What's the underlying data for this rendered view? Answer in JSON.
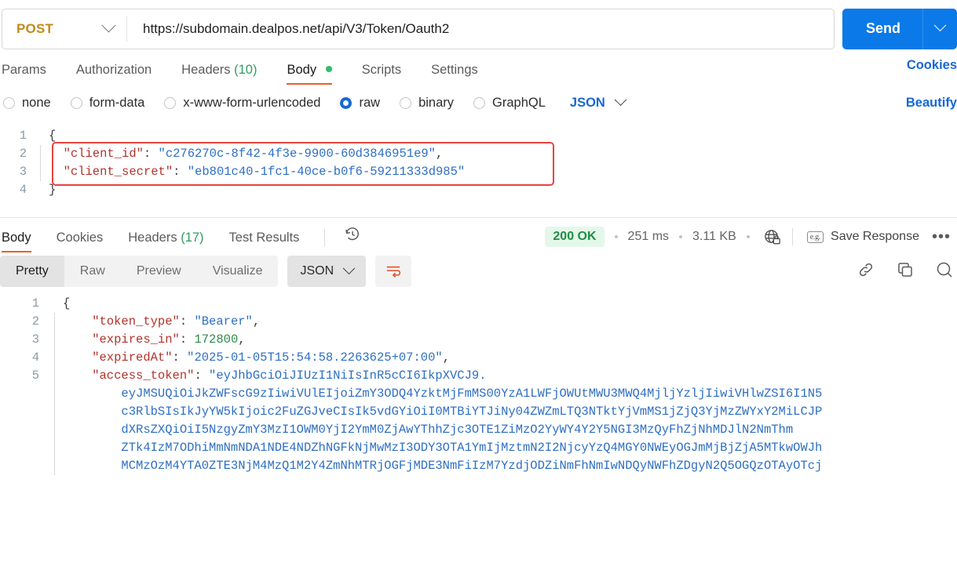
{
  "request": {
    "method": "POST",
    "url": "https://subdomain.dealpos.net/api/V3/Token/Oauth2",
    "send_label": "Send",
    "tabs": [
      {
        "label": "Params",
        "count": "",
        "active": false,
        "dot": false
      },
      {
        "label": "Authorization",
        "count": "",
        "active": false,
        "dot": false
      },
      {
        "label": "Headers",
        "count": "(10)",
        "active": false,
        "dot": false
      },
      {
        "label": "Body",
        "count": "",
        "active": true,
        "dot": true
      },
      {
        "label": "Scripts",
        "count": "",
        "active": false,
        "dot": false
      },
      {
        "label": "Settings",
        "count": "",
        "active": false,
        "dot": false
      }
    ],
    "cookies_link": "Cookies",
    "beautify_link": "Beautify",
    "body_types": [
      {
        "label": "none",
        "selected": false
      },
      {
        "label": "form-data",
        "selected": false
      },
      {
        "label": "x-www-form-urlencoded",
        "selected": false
      },
      {
        "label": "raw",
        "selected": true
      },
      {
        "label": "binary",
        "selected": false
      },
      {
        "label": "GraphQL",
        "selected": false
      }
    ],
    "raw_format": "JSON",
    "body_lines": [
      {
        "num": "1",
        "rule": false,
        "segments": [
          {
            "t": "{",
            "c": "p"
          }
        ]
      },
      {
        "num": "2",
        "rule": true,
        "segments": [
          {
            "t": "  \"client_id\"",
            "c": "k"
          },
          {
            "t": ": ",
            "c": "p"
          },
          {
            "t": "\"c276270c-8f42-4f3e-9900-60d3846951e9\"",
            "c": "s"
          },
          {
            "t": ",",
            "c": "p"
          }
        ]
      },
      {
        "num": "3",
        "rule": true,
        "segments": [
          {
            "t": "  \"client_secret\"",
            "c": "k"
          },
          {
            "t": ": ",
            "c": "p"
          },
          {
            "t": "\"eb801c40-1fc1-40ce-b0f6-59211333d985\"",
            "c": "s"
          }
        ]
      },
      {
        "num": "4",
        "rule": false,
        "segments": [
          {
            "t": "}",
            "c": "p"
          }
        ]
      }
    ]
  },
  "response": {
    "tabs": [
      {
        "label": "Body",
        "count": "",
        "active": true
      },
      {
        "label": "Cookies",
        "count": "",
        "active": false
      },
      {
        "label": "Headers",
        "count": "(17)",
        "active": false
      },
      {
        "label": "Test Results",
        "count": "",
        "active": false
      }
    ],
    "status": "200 OK",
    "time": "251 ms",
    "size": "3.11 KB",
    "save_response": "Save Response",
    "eg_badge": "e.g.",
    "view_modes": [
      {
        "label": "Pretty",
        "active": true
      },
      {
        "label": "Raw",
        "active": false
      },
      {
        "label": "Preview",
        "active": false
      },
      {
        "label": "Visualize",
        "active": false
      }
    ],
    "format": "JSON",
    "body_lines": [
      {
        "num": "1",
        "rule": false,
        "segments": [
          {
            "t": "{",
            "c": "p"
          }
        ]
      },
      {
        "num": "2",
        "rule": true,
        "segments": [
          {
            "t": "    \"token_type\"",
            "c": "k"
          },
          {
            "t": ": ",
            "c": "p"
          },
          {
            "t": "\"Bearer\"",
            "c": "s"
          },
          {
            "t": ",",
            "c": "p"
          }
        ]
      },
      {
        "num": "3",
        "rule": true,
        "segments": [
          {
            "t": "    \"expires_in\"",
            "c": "k"
          },
          {
            "t": ": ",
            "c": "p"
          },
          {
            "t": "172800",
            "c": "n"
          },
          {
            "t": ",",
            "c": "p"
          }
        ]
      },
      {
        "num": "4",
        "rule": true,
        "segments": [
          {
            "t": "    \"expiredAt\"",
            "c": "k"
          },
          {
            "t": ": ",
            "c": "p"
          },
          {
            "t": "\"2025-01-05T15:54:58.2263625+07:00\"",
            "c": "s"
          },
          {
            "t": ",",
            "c": "p"
          }
        ]
      },
      {
        "num": "5",
        "rule": true,
        "segments": [
          {
            "t": "    \"access_token\"",
            "c": "k"
          },
          {
            "t": ": ",
            "c": "p"
          },
          {
            "t": "\"eyJhbGciOiJIUzI1NiIsInR5cCI6IkpXVCJ9.",
            "c": "s"
          }
        ]
      },
      {
        "num": "",
        "rule": true,
        "segments": [
          {
            "t": "        eyJMSUQiOiJkZWFscG9zIiwiVUlEIjoiZmY3ODQ4YzktMjFmMS00YzA1LWFjOWUtMWU3MWQ4MjljYzljIiwiVHlwZSI6I1N5",
            "c": "s"
          }
        ]
      },
      {
        "num": "",
        "rule": true,
        "segments": [
          {
            "t": "        c3RlbSIsIkJyYW5kIjoic2FuZGJveCIsIk5vdGYiOiI0MTBiYTJiNy04ZWZmLTQ3NTktYjVmMS1jZjQ3YjMzZWYxY2MiLCJP",
            "c": "s"
          }
        ]
      },
      {
        "num": "",
        "rule": true,
        "segments": [
          {
            "t": "        dXRsZXQiOiI5NzgyZmY3MzI1OWM0YjI2YmM0ZjAwYThhZjc3OTE1ZiMzO2YyWY4Y2Y5NGI3MzQyFhZjNhMDJlN2NmThm",
            "c": "s"
          }
        ]
      },
      {
        "num": "",
        "rule": true,
        "segments": [
          {
            "t": "        ZTk4IzM7ODhiMmNmNDA1NDE4NDZhNGFkNjMwMzI3ODY3OTA1YmIjMztmN2I2NjcyYzQ4MGY0NWEyOGJmMjBjZjA5MTkwOWJh",
            "c": "s"
          }
        ]
      },
      {
        "num": "",
        "rule": true,
        "segments": [
          {
            "t": "        MCMzOzM4YTA0ZTE3NjM4MzQ1M2Y4ZmNhMTRjOGFjMDE3NmFiIzM7YzdjODZiNmFhNmIwNDQyNWFhZDgyN2Q5OGQzOTAyOTcj",
            "c": "s"
          }
        ]
      }
    ]
  }
}
